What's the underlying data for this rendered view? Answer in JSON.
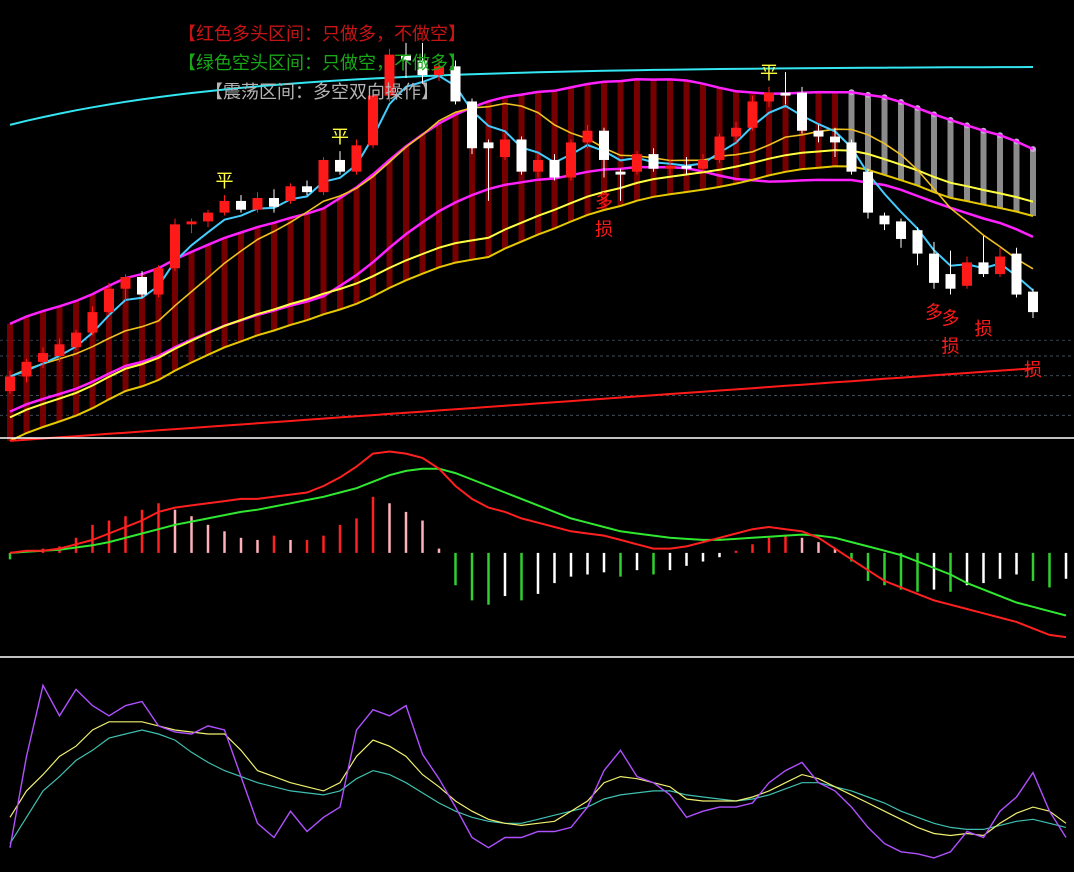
{
  "colors": {
    "background": "#000000",
    "bull": "#ff1a1a",
    "bear": "#ffffff",
    "bull_band": "#8b0000",
    "bear_band": "#9a9a9a",
    "cyan_line": "#33e6f2",
    "magenta_band": "#ff22ff",
    "yellow_line": "#ffff40",
    "gold_line": "#e6c800",
    "red_support": "#ff1a1a",
    "fast_line": "#44ccff",
    "dif_line": "#ff2020",
    "dea_line": "#30e830",
    "kdj_k": "#b050ff",
    "kdj_d": "#f0f070",
    "kdj_j": "#40c0b0",
    "separator": "#ffffff"
  },
  "legend": [
    {
      "text": "【红色多头区间：只做多，不做空】",
      "color": "#c81414"
    },
    {
      "text": "【绿色空头区间：只做空，不做多】",
      "color": "#18a818"
    },
    {
      "text": "【震荡区间：多空双向操作】",
      "color": "#b4b4b4"
    }
  ],
  "chart_data": [
    {
      "type": "candlestick",
      "panel": "main",
      "candles": [
        [
          5,
          10,
          4,
          12
        ],
        [
          10,
          15,
          8,
          16
        ],
        [
          15,
          18,
          13,
          20
        ],
        [
          17,
          21,
          15,
          23
        ],
        [
          20,
          25,
          19,
          26
        ],
        [
          25,
          32,
          24,
          34
        ],
        [
          32,
          40,
          31,
          42
        ],
        [
          40,
          44,
          36,
          45
        ],
        [
          44,
          38,
          37,
          46
        ],
        [
          38,
          47,
          37,
          48
        ],
        [
          47,
          62,
          46,
          64
        ],
        [
          62,
          63,
          59,
          64
        ],
        [
          63,
          66,
          61,
          67
        ],
        [
          66,
          70,
          65,
          72
        ],
        [
          70,
          67,
          66,
          72
        ],
        [
          67,
          71,
          66,
          73
        ],
        [
          71,
          68,
          66,
          74
        ],
        [
          70,
          75,
          69,
          76
        ],
        [
          75,
          73,
          72,
          77
        ],
        [
          73,
          84,
          72,
          85
        ],
        [
          84,
          80,
          79,
          87
        ],
        [
          80,
          89,
          79,
          91
        ],
        [
          89,
          106,
          88,
          108
        ],
        [
          106,
          120,
          104,
          122
        ],
        [
          120,
          118,
          112,
          124
        ],
        [
          118,
          113,
          110,
          124
        ],
        [
          113,
          116,
          111,
          118
        ],
        [
          116,
          104,
          103,
          118
        ],
        [
          104,
          88,
          86,
          105
        ],
        [
          90,
          88,
          70,
          91
        ],
        [
          85,
          91,
          84,
          93
        ],
        [
          91,
          80,
          79,
          92
        ],
        [
          80,
          84,
          78,
          86
        ],
        [
          84,
          78,
          77,
          86
        ],
        [
          78,
          90,
          77,
          91
        ],
        [
          90,
          94,
          88,
          96
        ],
        [
          94,
          84,
          78,
          95
        ],
        [
          80,
          79,
          70,
          81
        ],
        [
          80,
          86,
          79,
          87
        ],
        [
          86,
          81,
          80,
          88
        ],
        [
          81,
          82,
          79,
          84
        ],
        [
          82,
          81,
          79,
          85
        ],
        [
          81,
          84,
          80,
          86
        ],
        [
          84,
          92,
          83,
          93
        ],
        [
          92,
          95,
          90,
          97
        ],
        [
          95,
          104,
          94,
          106
        ],
        [
          104,
          107,
          102,
          109
        ],
        [
          107,
          106,
          103,
          114
        ],
        [
          107,
          94,
          93,
          109
        ],
        [
          94,
          92,
          90,
          96
        ],
        [
          92,
          90,
          85,
          95
        ],
        [
          90,
          80,
          79,
          91
        ],
        [
          80,
          66,
          64,
          81
        ],
        [
          65,
          62,
          60,
          66
        ],
        [
          63,
          57,
          54,
          64
        ],
        [
          60,
          52,
          48,
          61
        ],
        [
          52,
          42,
          40,
          56
        ],
        [
          45,
          40,
          38,
          53
        ],
        [
          41,
          49,
          40,
          51
        ],
        [
          49,
          45,
          44,
          58
        ],
        [
          45,
          51,
          44,
          54
        ],
        [
          52,
          38,
          37,
          54
        ],
        [
          39,
          32,
          30,
          40
        ]
      ],
      "signal_marks": [
        {
          "text": "平",
          "index": 13,
          "color": "#ffff40"
        },
        {
          "text": "平",
          "index": 20,
          "color": "#ffff40"
        },
        {
          "text": "平",
          "index": 46,
          "color": "#ffff40"
        },
        {
          "text": "多",
          "index": 36,
          "color": "#ff1a1a"
        },
        {
          "text": "多",
          "index": 56,
          "color": "#ff1a1a"
        },
        {
          "text": "多",
          "index": 57,
          "color": "#ff1a1a"
        },
        {
          "text": "损",
          "index": 36,
          "color": "#ff1a1a"
        },
        {
          "text": "损",
          "index": 57,
          "color": "#ff1a1a"
        },
        {
          "text": "损",
          "index": 59,
          "color": "#ff1a1a"
        },
        {
          "text": "损",
          "index": 64,
          "color": "#ff1a1a"
        }
      ]
    },
    {
      "type": "bar",
      "panel": "macd",
      "series": [
        {
          "name": "MACD",
          "values": [
            -0.3,
            0.0,
            0.2,
            0.3,
            0.7,
            1.3,
            1.5,
            1.7,
            2.0,
            2.3,
            2.0,
            1.7,
            1.3,
            1.0,
            0.7,
            0.6,
            0.8,
            0.6,
            0.6,
            0.8,
            1.3,
            1.6,
            2.6,
            2.3,
            1.9,
            1.5,
            0.2,
            -1.5,
            -2.2,
            -2.4,
            -2.0,
            -2.2,
            -1.9,
            -1.4,
            -1.1,
            -1.0,
            -0.9,
            -1.1,
            -0.8,
            -1.0,
            -0.8,
            -0.6,
            -0.4,
            -0.2,
            0.1,
            0.4,
            0.7,
            0.8,
            0.7,
            0.5,
            0.2,
            -0.4,
            -1.3,
            -1.5,
            -1.7,
            -1.8,
            -1.7,
            -1.8,
            -1.5,
            -1.4,
            -1.2,
            -1.0,
            -1.3,
            -1.6,
            -1.2
          ]
        },
        {
          "name": "DIF",
          "values": [
            0.0,
            0.1,
            0.1,
            0.2,
            0.4,
            0.6,
            0.9,
            1.2,
            1.5,
            1.9,
            2.1,
            2.2,
            2.3,
            2.4,
            2.5,
            2.5,
            2.6,
            2.7,
            2.8,
            3.1,
            3.5,
            4.0,
            4.6,
            4.7,
            4.6,
            4.4,
            3.9,
            3.1,
            2.5,
            2.1,
            1.9,
            1.6,
            1.4,
            1.2,
            1.0,
            0.9,
            0.8,
            0.6,
            0.4,
            0.2,
            0.2,
            0.3,
            0.5,
            0.7,
            0.9,
            1.1,
            1.2,
            1.1,
            1.0,
            0.7,
            0.2,
            -0.3,
            -0.8,
            -1.3,
            -1.6,
            -1.9,
            -2.2,
            -2.4,
            -2.6,
            -2.8,
            -3.0,
            -3.2,
            -3.5,
            -3.8,
            -3.9
          ]
        },
        {
          "name": "DEA",
          "values": [
            0.0,
            0.05,
            0.1,
            0.15,
            0.25,
            0.35,
            0.5,
            0.7,
            0.9,
            1.1,
            1.3,
            1.45,
            1.6,
            1.75,
            1.9,
            2.0,
            2.15,
            2.3,
            2.45,
            2.6,
            2.8,
            3.0,
            3.3,
            3.6,
            3.8,
            3.9,
            3.9,
            3.7,
            3.4,
            3.1,
            2.8,
            2.5,
            2.2,
            1.9,
            1.6,
            1.4,
            1.2,
            1.0,
            0.9,
            0.8,
            0.7,
            0.65,
            0.6,
            0.6,
            0.65,
            0.7,
            0.75,
            0.8,
            0.85,
            0.8,
            0.7,
            0.5,
            0.3,
            0.1,
            -0.1,
            -0.4,
            -0.7,
            -1.0,
            -1.4,
            -1.7,
            -2.0,
            -2.3,
            -2.5,
            -2.7,
            -2.9
          ]
        }
      ]
    },
    {
      "type": "line",
      "panel": "kdj",
      "series": [
        {
          "name": "K",
          "values": [
            10,
            55,
            90,
            75,
            88,
            80,
            75,
            80,
            82,
            70,
            67,
            66,
            70,
            68,
            45,
            22,
            15,
            28,
            18,
            25,
            30,
            68,
            78,
            75,
            80,
            56,
            44,
            30,
            15,
            10,
            15,
            15,
            18,
            18,
            20,
            30,
            48,
            58,
            45,
            42,
            36,
            25,
            28,
            30,
            30,
            32,
            42,
            48,
            52,
            42,
            38,
            30,
            20,
            12,
            8,
            7,
            5,
            8,
            18,
            15,
            28,
            35,
            47,
            28,
            15
          ]
        },
        {
          "name": "D",
          "values": [
            25,
            38,
            46,
            55,
            60,
            68,
            72,
            72,
            72,
            70,
            68,
            67,
            66,
            66,
            58,
            48,
            45,
            42,
            40,
            38,
            42,
            55,
            63,
            60,
            55,
            46,
            40,
            33,
            28,
            24,
            22,
            21,
            22,
            23,
            28,
            33,
            42,
            45,
            44,
            42,
            40,
            34,
            33,
            33,
            33,
            35,
            38,
            42,
            46,
            44,
            40,
            36,
            32,
            28,
            24,
            20,
            17,
            16,
            17,
            16,
            22,
            27,
            30,
            28,
            22
          ]
        },
        {
          "name": "J",
          "values": [
            12,
            25,
            38,
            45,
            53,
            58,
            64,
            66,
            68,
            66,
            63,
            57,
            52,
            48,
            45,
            42,
            40,
            38,
            37,
            36,
            38,
            44,
            48,
            46,
            42,
            37,
            32,
            28,
            25,
            23,
            22,
            22,
            24,
            26,
            28,
            30,
            34,
            36,
            37,
            38,
            38,
            36,
            35,
            34,
            33,
            34,
            36,
            39,
            42,
            42,
            40,
            38,
            35,
            32,
            28,
            25,
            22,
            20,
            19,
            19,
            21,
            23,
            24,
            22,
            20
          ]
        }
      ]
    }
  ]
}
